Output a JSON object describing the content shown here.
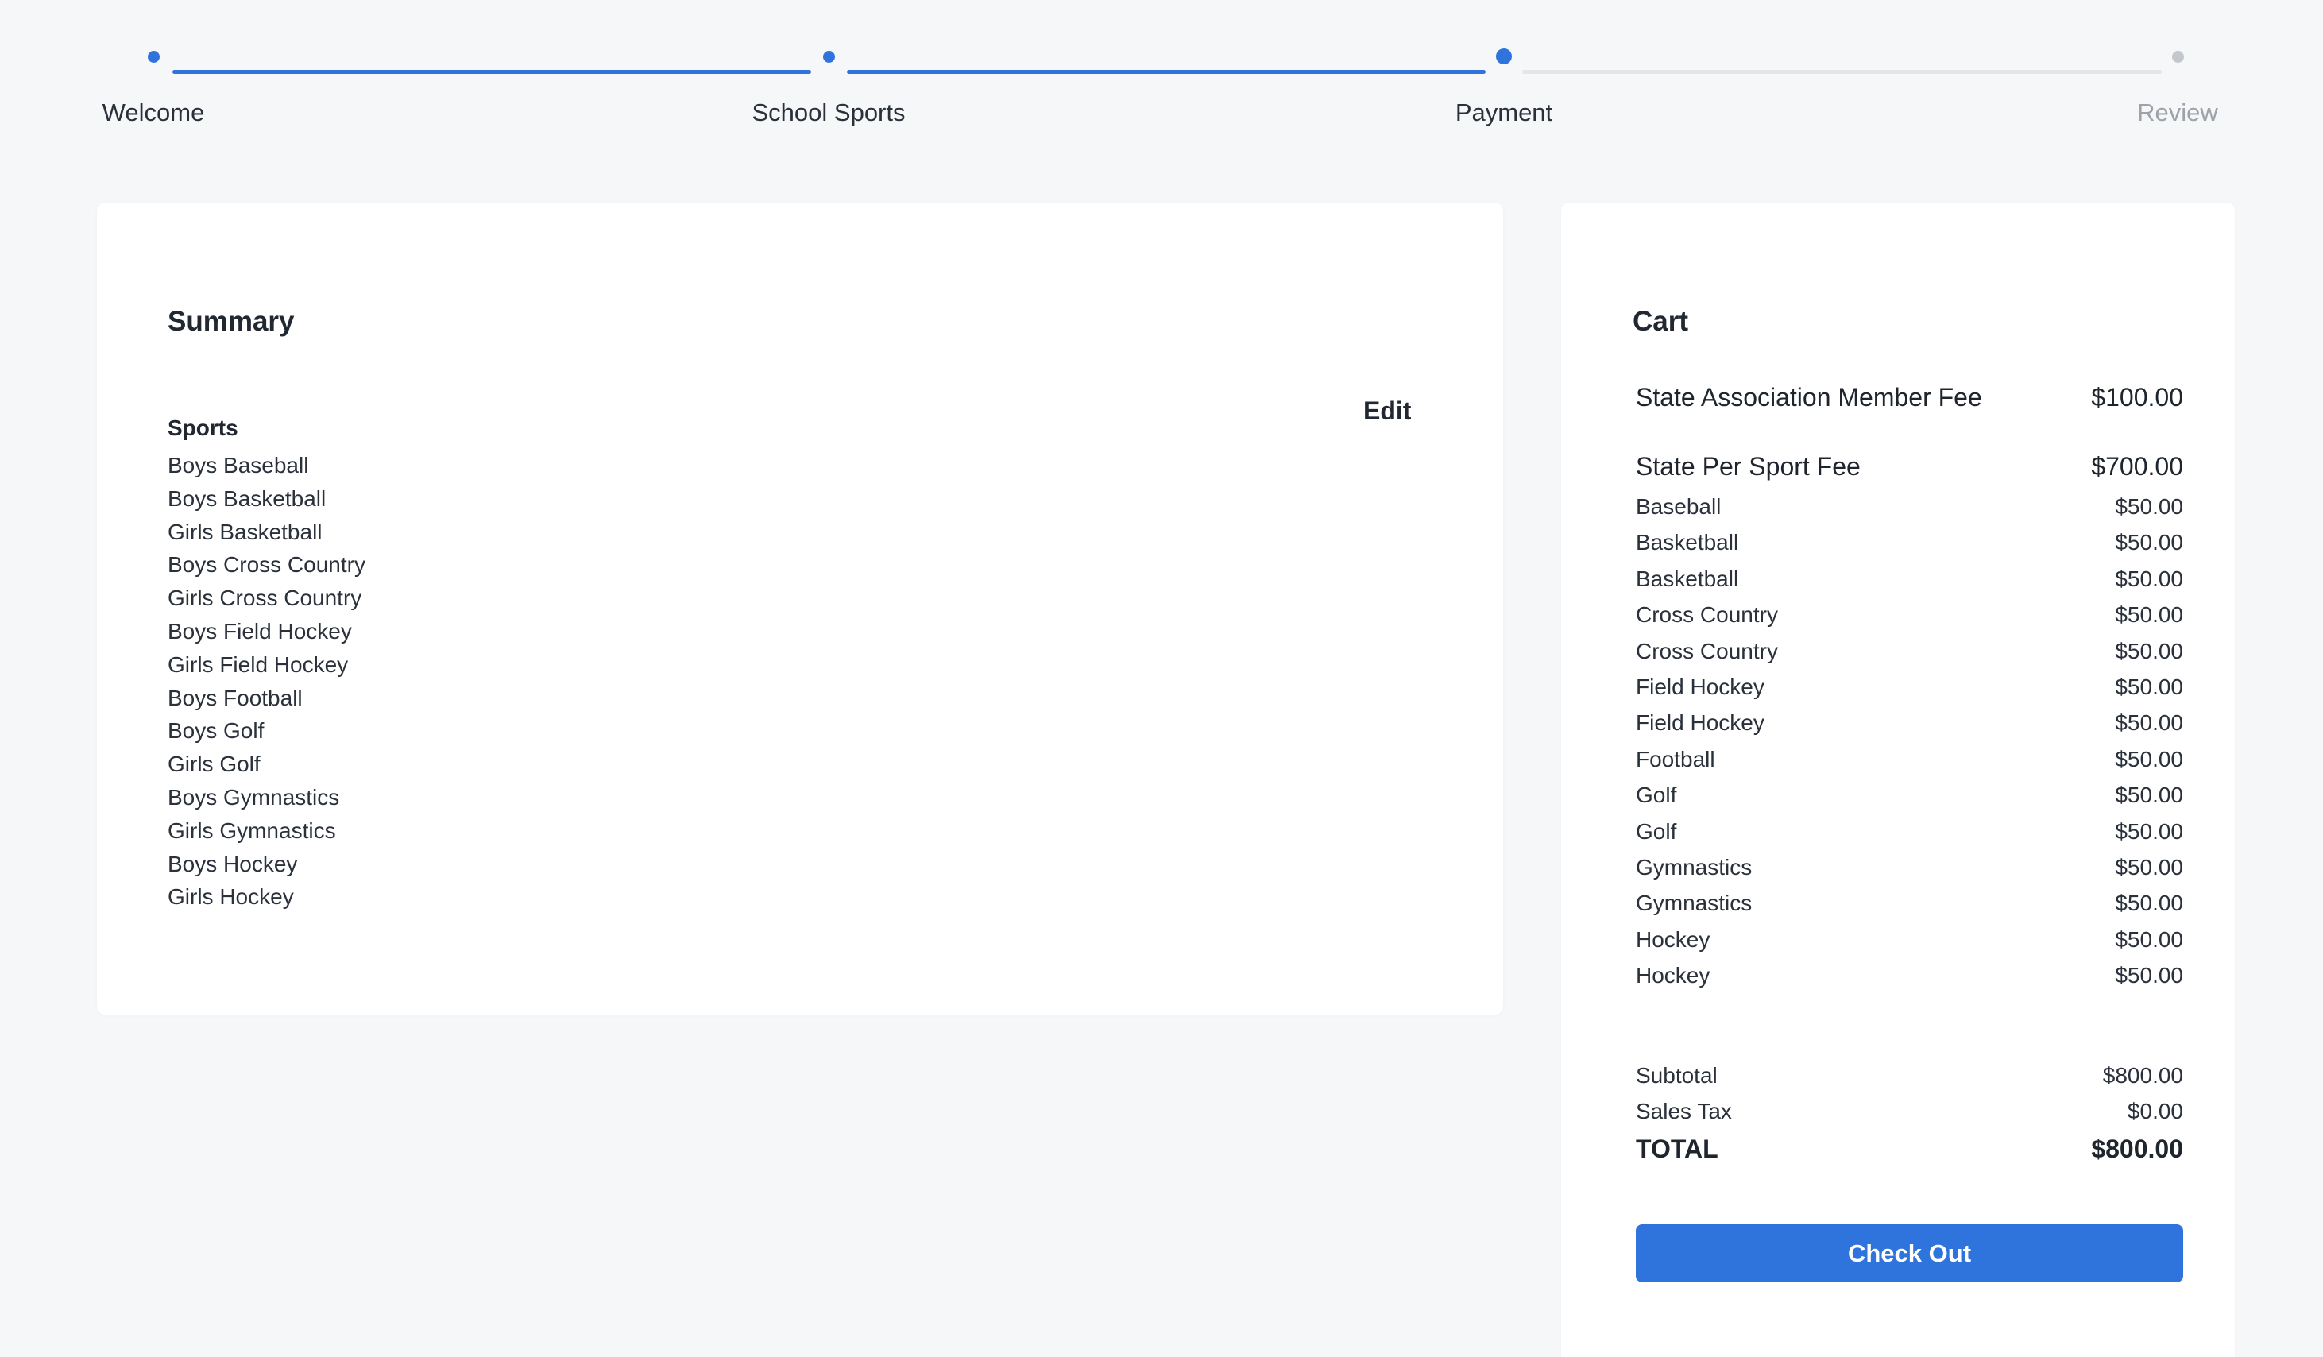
{
  "stepper": {
    "steps": [
      {
        "label": "Welcome",
        "state": "done"
      },
      {
        "label": "School Sports",
        "state": "done"
      },
      {
        "label": "Payment",
        "state": "current"
      },
      {
        "label": "Review",
        "state": "todo"
      }
    ],
    "colors": {
      "active": "#2e74dc",
      "inactive": "#c4c7cc"
    }
  },
  "summary": {
    "title": "Summary",
    "edit_label": "Edit",
    "sports_heading": "Sports",
    "sports": [
      "Boys Baseball",
      "Boys Basketball",
      "Girls Basketball",
      "Boys Cross Country",
      "Girls Cross Country",
      "Boys Field Hockey",
      "Girls Field Hockey",
      "Boys Football",
      "Boys Golf",
      "Girls Golf",
      "Boys Gymnastics",
      "Girls Gymnastics",
      "Boys Hockey",
      "Girls Hockey"
    ]
  },
  "cart": {
    "title": "Cart",
    "member_fee": {
      "label": "State Association Member Fee",
      "amount": "$100.00"
    },
    "per_sport_fee": {
      "label": "State Per Sport Fee",
      "amount": "$700.00"
    },
    "items": [
      {
        "name": "Baseball",
        "amount": "$50.00"
      },
      {
        "name": "Basketball",
        "amount": "$50.00"
      },
      {
        "name": "Basketball",
        "amount": "$50.00"
      },
      {
        "name": "Cross Country",
        "amount": "$50.00"
      },
      {
        "name": "Cross Country",
        "amount": "$50.00"
      },
      {
        "name": "Field Hockey",
        "amount": "$50.00"
      },
      {
        "name": "Field Hockey",
        "amount": "$50.00"
      },
      {
        "name": "Football",
        "amount": "$50.00"
      },
      {
        "name": "Golf",
        "amount": "$50.00"
      },
      {
        "name": "Golf",
        "amount": "$50.00"
      },
      {
        "name": "Gymnastics",
        "amount": "$50.00"
      },
      {
        "name": "Gymnastics",
        "amount": "$50.00"
      },
      {
        "name": "Hockey",
        "amount": "$50.00"
      },
      {
        "name": "Hockey",
        "amount": "$50.00"
      }
    ],
    "subtotal": {
      "label": "Subtotal",
      "amount": "$800.00"
    },
    "sales_tax": {
      "label": "Sales Tax",
      "amount": "$0.00"
    },
    "total": {
      "label": "TOTAL",
      "amount": "$800.00"
    },
    "checkout_label": "Check Out",
    "accent_color": "#2e74dc"
  }
}
